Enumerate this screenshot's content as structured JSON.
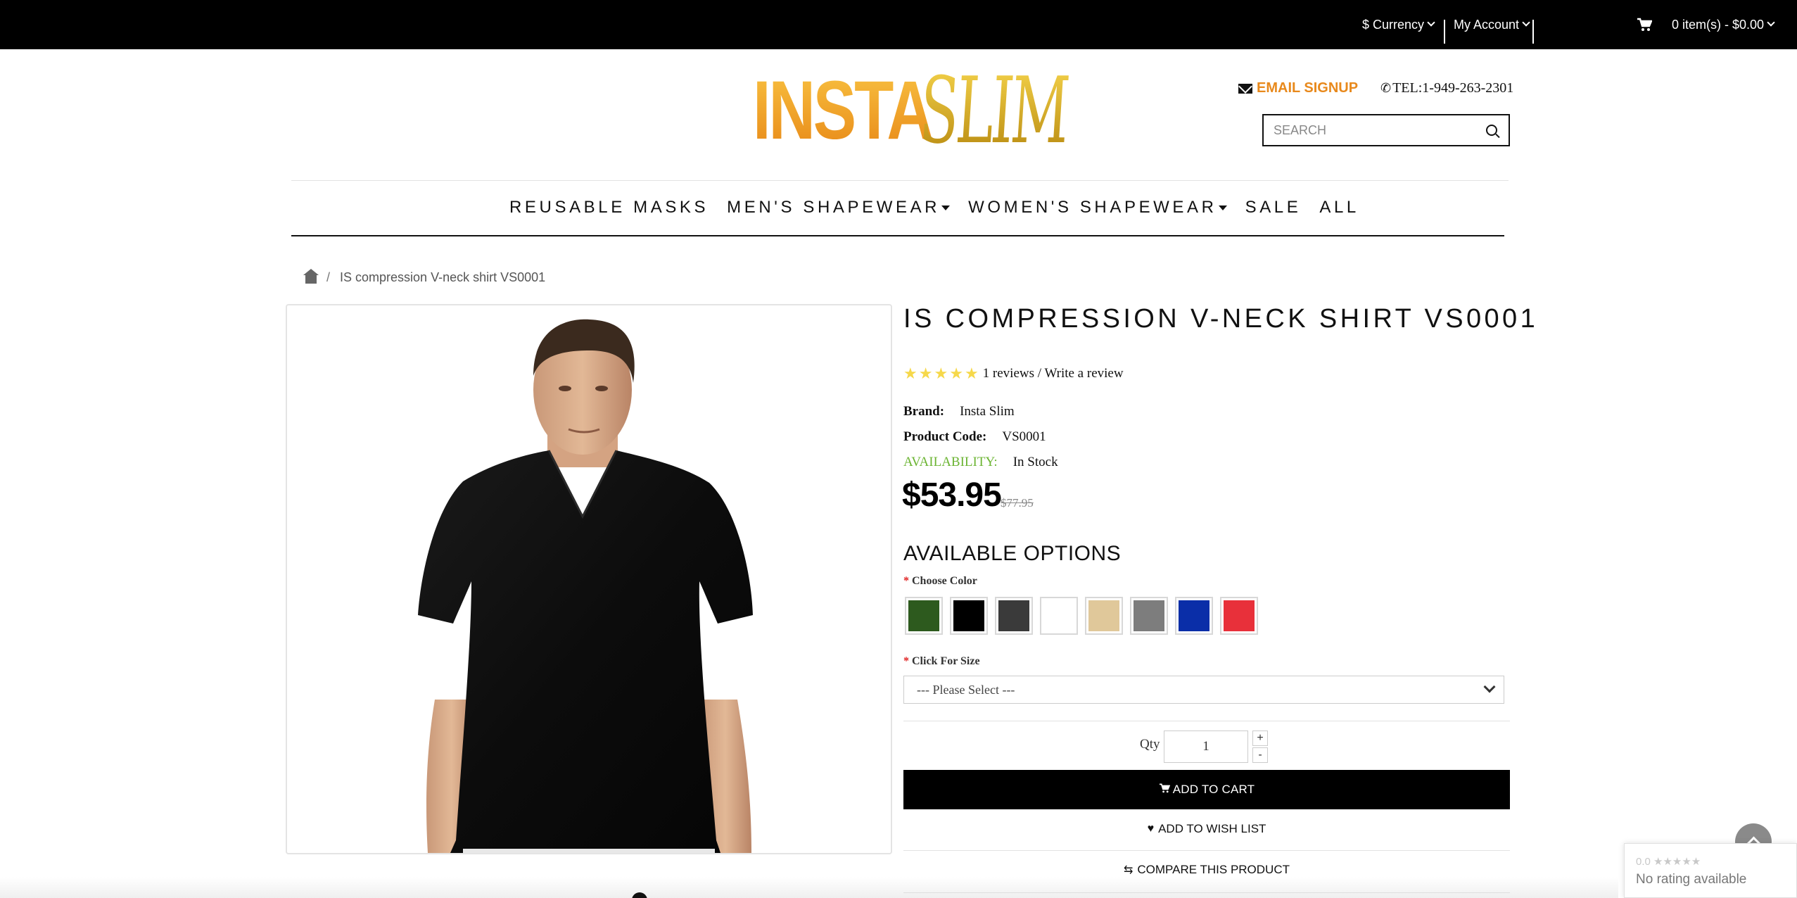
{
  "topbar": {
    "currency": "$ Currency",
    "account": "My Account",
    "cart": "0 item(s) - $0.00"
  },
  "header": {
    "logo_word1": "INSTA",
    "logo_word2": "SLIM",
    "email_signup": "EMAIL SIGNUP",
    "phone": "TEL:1-949-263-2301",
    "search_placeholder": "SEARCH"
  },
  "nav": {
    "items": [
      {
        "label": "REUSABLE MASKS"
      },
      {
        "label": "MEN'S SHAPEWEAR"
      },
      {
        "label": "WOMEN'S SHAPEWEAR"
      },
      {
        "label": "SALE"
      },
      {
        "label": "ALL"
      }
    ]
  },
  "breadcrumb": {
    "separator": "/",
    "current": "IS compression V-neck shirt VS0001"
  },
  "product": {
    "title": "IS COMPRESSION V-NECK SHIRT VS0001",
    "rating_stars": 5,
    "reviews": "1 reviews / Write a review",
    "brand_label": "Brand:",
    "brand": "Insta Slim",
    "code_label": "Product Code:",
    "code": "VS0001",
    "availability_label": "AVAILABILITY:",
    "availability": "In Stock",
    "price": "$53.95",
    "old_price": "$77.95"
  },
  "options": {
    "heading": "AVAILABLE OPTIONS",
    "required_mark": "*",
    "color_label": "Choose Color",
    "colors": [
      "#2d5a1e",
      "#000000",
      "#3a3a3a",
      "#ffffff",
      "#e0c89a",
      "#7d7d7d",
      "#0a2ea8",
      "#e8303a"
    ],
    "size_label": "Click For Size",
    "size_selected": "--- Please Select ---"
  },
  "cart": {
    "qty_label": "Qty",
    "qty_value": "1",
    "plus": "+",
    "minus": "-",
    "add_to_cart": "ADD TO CART",
    "wishlist": "ADD TO WISH LIST",
    "compare": "COMPARE THIS PRODUCT"
  },
  "widget": {
    "rating_top": "0.0 ★★★★★",
    "no_rating": "No rating available"
  },
  "colors": {
    "accent_orange": "#e8891c",
    "availability_green": "#6bb432",
    "star_yellow": "#f6d84a"
  }
}
